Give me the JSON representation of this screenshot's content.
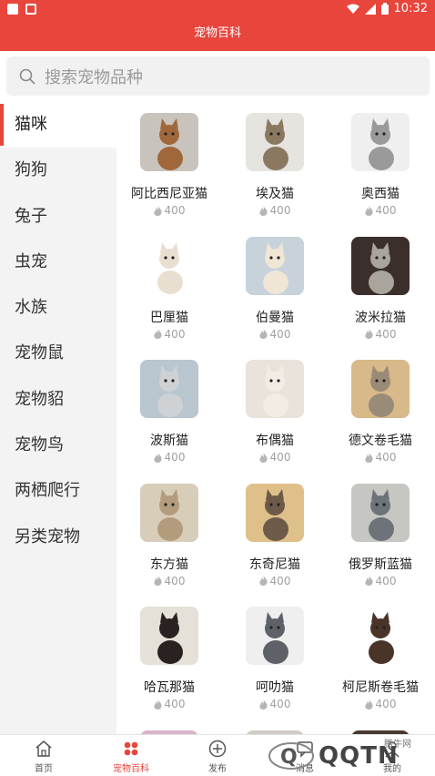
{
  "status": {
    "time": "10:32"
  },
  "app": {
    "title": "宠物百科"
  },
  "search": {
    "placeholder": "搜索宠物品种"
  },
  "sidebar": {
    "items": [
      {
        "label": "猫咪",
        "active": true
      },
      {
        "label": "狗狗"
      },
      {
        "label": "兔子"
      },
      {
        "label": "虫宠"
      },
      {
        "label": "水族"
      },
      {
        "label": "宠物鼠"
      },
      {
        "label": "宠物貂"
      },
      {
        "label": "宠物鸟"
      },
      {
        "label": "两栖爬行"
      },
      {
        "label": "另类宠物"
      }
    ]
  },
  "breeds": [
    {
      "name": "阿比西尼亚猫",
      "count": "400",
      "bg": "#c9c3bd",
      "cat": "#a0683a"
    },
    {
      "name": "埃及猫",
      "count": "400",
      "bg": "#e6e4df",
      "cat": "#8a7860"
    },
    {
      "name": "奥西猫",
      "count": "400",
      "bg": "#efefef",
      "cat": "#9a9a9a"
    },
    {
      "name": "巴厘猫",
      "count": "400",
      "bg": "#ffffff",
      "cat": "#e9dfd1"
    },
    {
      "name": "伯曼猫",
      "count": "400",
      "bg": "#c7d2da",
      "cat": "#efe6d6"
    },
    {
      "name": "波米拉猫",
      "count": "400",
      "bg": "#3a2f2a",
      "cat": "#a9a49c"
    },
    {
      "name": "波斯猫",
      "count": "400",
      "bg": "#b9c6d0",
      "cat": "#cfd2d4"
    },
    {
      "name": "布偶猫",
      "count": "400",
      "bg": "#e9e3dc",
      "cat": "#f2ece4"
    },
    {
      "name": "德文卷毛猫",
      "count": "400",
      "bg": "#d7b98a",
      "cat": "#9a8a78"
    },
    {
      "name": "东方猫",
      "count": "400",
      "bg": "#d8cdb9",
      "cat": "#b39c7c"
    },
    {
      "name": "东奇尼猫",
      "count": "400",
      "bg": "#e0c08a",
      "cat": "#6e5a48"
    },
    {
      "name": "俄罗斯蓝猫",
      "count": "400",
      "bg": "#c6c6c2",
      "cat": "#6e737a"
    },
    {
      "name": "哈瓦那猫",
      "count": "400",
      "bg": "#e6e1d8",
      "cat": "#2a2220"
    },
    {
      "name": "呵叻猫",
      "count": "400",
      "bg": "#efefef",
      "cat": "#5e6268"
    },
    {
      "name": "柯尼斯卷毛猫",
      "count": "400",
      "bg": "#ffffff",
      "cat": "#4a3428"
    }
  ],
  "tabs": [
    {
      "label": "首页",
      "icon": "home-icon"
    },
    {
      "label": "宠物百科",
      "icon": "paw-icon",
      "active": true
    },
    {
      "label": "发布",
      "icon": "plus-circle-icon"
    },
    {
      "label": "消息",
      "icon": "message-icon"
    },
    {
      "label": "我的",
      "icon": "user-icon"
    }
  ],
  "watermark": {
    "brand": "QQTN",
    "sub": "腾牛网"
  },
  "colors": {
    "accent": "#e8453c",
    "sidebar_bg": "#f3f3f3",
    "muted": "#a0a0a0"
  }
}
